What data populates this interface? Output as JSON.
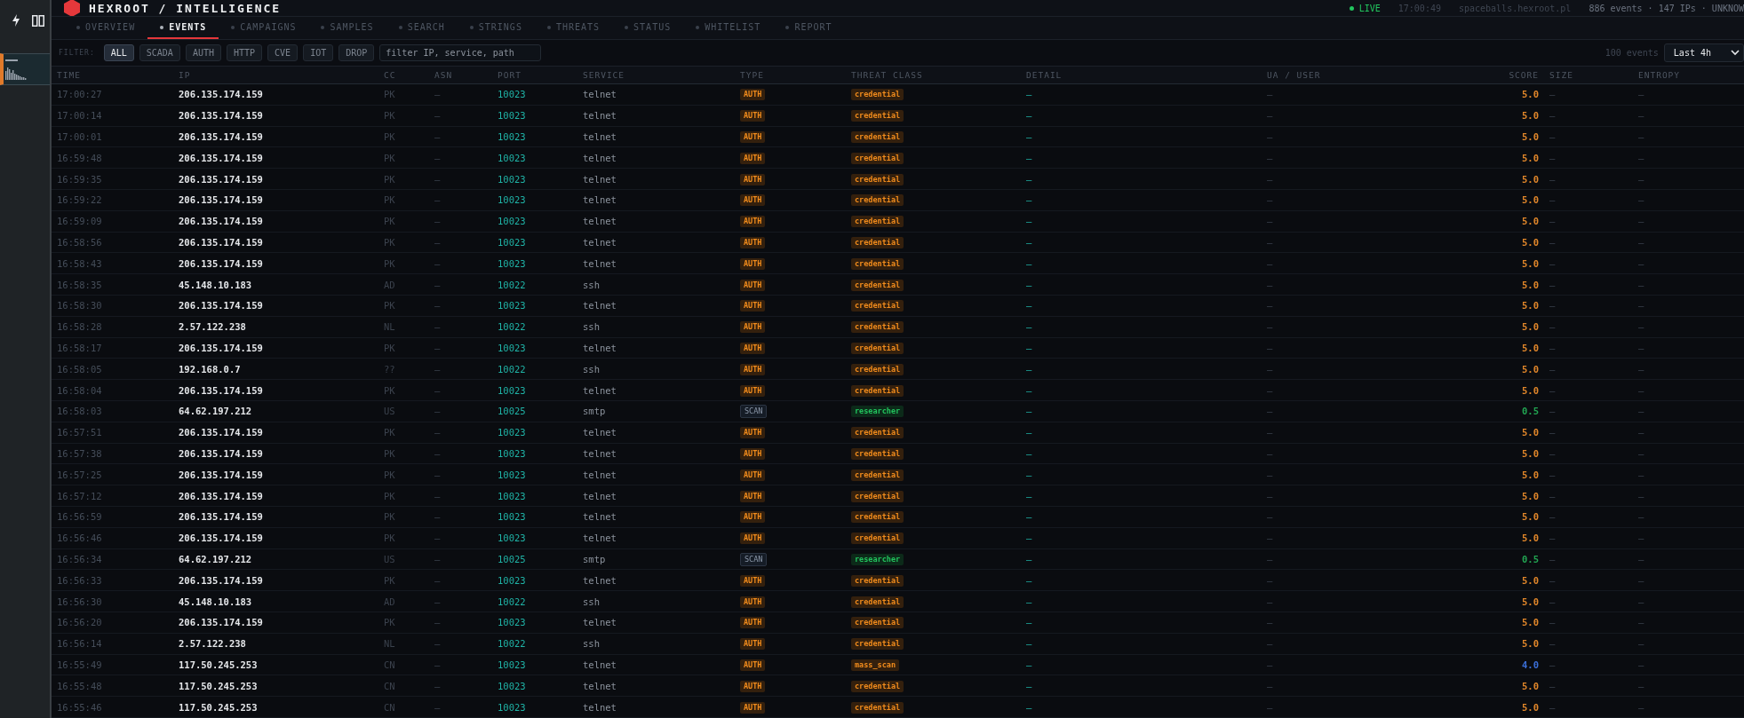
{
  "app": {
    "title": "HEXROOT / INTELLIGENCE"
  },
  "status": {
    "live": "LIVE",
    "clock": "17:00:49",
    "host": "spaceballs.hexroot.pl",
    "summary": "886 events · 147 IPs · UNKNOW"
  },
  "tabs": [
    {
      "label": "OVERVIEW",
      "selected": false
    },
    {
      "label": "EVENTS",
      "selected": true
    },
    {
      "label": "CAMPAIGNS",
      "selected": false
    },
    {
      "label": "SAMPLES",
      "selected": false
    },
    {
      "label": "SEARCH",
      "selected": false
    },
    {
      "label": "STRINGS",
      "selected": false
    },
    {
      "label": "THREATS",
      "selected": false
    },
    {
      "label": "STATUS",
      "selected": false
    },
    {
      "label": "WHITELIST",
      "selected": false
    },
    {
      "label": "REPORT",
      "selected": false
    }
  ],
  "filter": {
    "label": "FILTER:",
    "chips": [
      {
        "label": "ALL",
        "selected": true
      },
      {
        "label": "SCADA",
        "selected": false
      },
      {
        "label": "AUTH",
        "selected": false
      },
      {
        "label": "HTTP",
        "selected": false
      },
      {
        "label": "CVE",
        "selected": false
      },
      {
        "label": "IOT",
        "selected": false
      },
      {
        "label": "DROP",
        "selected": false
      }
    ],
    "search": {
      "placeholder": "filter IP, service, path"
    },
    "count": "100 events",
    "range": "Last 4h"
  },
  "table": {
    "columns": [
      "TIME",
      "IP",
      "CC",
      "ASN",
      "PORT",
      "SERVICE",
      "TYPE",
      "THREAT CLASS",
      "DETAIL",
      "UA / USER",
      "SCORE",
      "SIZE",
      "ENTROPY"
    ],
    "rows": [
      {
        "time": "17:00:27",
        "ip": "206.135.174.159",
        "cc": "PK",
        "asn": "—",
        "port": "10023",
        "service": "telnet",
        "type": {
          "text": "AUTH",
          "kind": "auth"
        },
        "threat_class": {
          "text": "credential",
          "kind": "alert"
        },
        "detail": "—",
        "ua": "—",
        "score": {
          "text": "5.0",
          "color": "#e0862a"
        },
        "size": "—",
        "entropy": "—"
      },
      {
        "time": "17:00:14",
        "ip": "206.135.174.159",
        "cc": "PK",
        "asn": "—",
        "port": "10023",
        "service": "telnet",
        "type": {
          "text": "AUTH",
          "kind": "auth"
        },
        "threat_class": {
          "text": "credential",
          "kind": "alert"
        },
        "detail": "—",
        "ua": "—",
        "score": {
          "text": "5.0",
          "color": "#e0862a"
        },
        "size": "—",
        "entropy": "—"
      },
      {
        "time": "17:00:01",
        "ip": "206.135.174.159",
        "cc": "PK",
        "asn": "—",
        "port": "10023",
        "service": "telnet",
        "type": {
          "text": "AUTH",
          "kind": "auth"
        },
        "threat_class": {
          "text": "credential",
          "kind": "alert"
        },
        "detail": "—",
        "ua": "—",
        "score": {
          "text": "5.0",
          "color": "#e0862a"
        },
        "size": "—",
        "entropy": "—"
      },
      {
        "time": "16:59:48",
        "ip": "206.135.174.159",
        "cc": "PK",
        "asn": "—",
        "port": "10023",
        "service": "telnet",
        "type": {
          "text": "AUTH",
          "kind": "auth"
        },
        "threat_class": {
          "text": "credential",
          "kind": "alert"
        },
        "detail": "—",
        "ua": "—",
        "score": {
          "text": "5.0",
          "color": "#e0862a"
        },
        "size": "—",
        "entropy": "—"
      },
      {
        "time": "16:59:35",
        "ip": "206.135.174.159",
        "cc": "PK",
        "asn": "—",
        "port": "10023",
        "service": "telnet",
        "type": {
          "text": "AUTH",
          "kind": "auth"
        },
        "threat_class": {
          "text": "credential",
          "kind": "alert"
        },
        "detail": "—",
        "ua": "—",
        "score": {
          "text": "5.0",
          "color": "#e0862a"
        },
        "size": "—",
        "entropy": "—"
      },
      {
        "time": "16:59:22",
        "ip": "206.135.174.159",
        "cc": "PK",
        "asn": "—",
        "port": "10023",
        "service": "telnet",
        "type": {
          "text": "AUTH",
          "kind": "auth"
        },
        "threat_class": {
          "text": "credential",
          "kind": "alert"
        },
        "detail": "—",
        "ua": "—",
        "score": {
          "text": "5.0",
          "color": "#e0862a"
        },
        "size": "—",
        "entropy": "—"
      },
      {
        "time": "16:59:09",
        "ip": "206.135.174.159",
        "cc": "PK",
        "asn": "—",
        "port": "10023",
        "service": "telnet",
        "type": {
          "text": "AUTH",
          "kind": "auth"
        },
        "threat_class": {
          "text": "credential",
          "kind": "alert"
        },
        "detail": "—",
        "ua": "—",
        "score": {
          "text": "5.0",
          "color": "#e0862a"
        },
        "size": "—",
        "entropy": "—"
      },
      {
        "time": "16:58:56",
        "ip": "206.135.174.159",
        "cc": "PK",
        "asn": "—",
        "port": "10023",
        "service": "telnet",
        "type": {
          "text": "AUTH",
          "kind": "auth"
        },
        "threat_class": {
          "text": "credential",
          "kind": "alert"
        },
        "detail": "—",
        "ua": "—",
        "score": {
          "text": "5.0",
          "color": "#e0862a"
        },
        "size": "—",
        "entropy": "—"
      },
      {
        "time": "16:58:43",
        "ip": "206.135.174.159",
        "cc": "PK",
        "asn": "—",
        "port": "10023",
        "service": "telnet",
        "type": {
          "text": "AUTH",
          "kind": "auth"
        },
        "threat_class": {
          "text": "credential",
          "kind": "alert"
        },
        "detail": "—",
        "ua": "—",
        "score": {
          "text": "5.0",
          "color": "#e0862a"
        },
        "size": "—",
        "entropy": "—"
      },
      {
        "time": "16:58:35",
        "ip": "45.148.10.183",
        "cc": "AD",
        "asn": "—",
        "port": "10022",
        "service": "ssh",
        "type": {
          "text": "AUTH",
          "kind": "auth"
        },
        "threat_class": {
          "text": "credential",
          "kind": "alert"
        },
        "detail": "—",
        "ua": "—",
        "score": {
          "text": "5.0",
          "color": "#e0862a"
        },
        "size": "—",
        "entropy": "—"
      },
      {
        "time": "16:58:30",
        "ip": "206.135.174.159",
        "cc": "PK",
        "asn": "—",
        "port": "10023",
        "service": "telnet",
        "type": {
          "text": "AUTH",
          "kind": "auth"
        },
        "threat_class": {
          "text": "credential",
          "kind": "alert"
        },
        "detail": "—",
        "ua": "—",
        "score": {
          "text": "5.0",
          "color": "#e0862a"
        },
        "size": "—",
        "entropy": "—"
      },
      {
        "time": "16:58:28",
        "ip": "2.57.122.238",
        "cc": "NL",
        "asn": "—",
        "port": "10022",
        "service": "ssh",
        "type": {
          "text": "AUTH",
          "kind": "auth"
        },
        "threat_class": {
          "text": "credential",
          "kind": "alert"
        },
        "detail": "—",
        "ua": "—",
        "score": {
          "text": "5.0",
          "color": "#e0862a"
        },
        "size": "—",
        "entropy": "—"
      },
      {
        "time": "16:58:17",
        "ip": "206.135.174.159",
        "cc": "PK",
        "asn": "—",
        "port": "10023",
        "service": "telnet",
        "type": {
          "text": "AUTH",
          "kind": "auth"
        },
        "threat_class": {
          "text": "credential",
          "kind": "alert"
        },
        "detail": "—",
        "ua": "—",
        "score": {
          "text": "5.0",
          "color": "#e0862a"
        },
        "size": "—",
        "entropy": "—"
      },
      {
        "time": "16:58:05",
        "ip": "192.168.0.7",
        "cc": "??",
        "asn": "—",
        "port": "10022",
        "service": "ssh",
        "type": {
          "text": "AUTH",
          "kind": "auth"
        },
        "threat_class": {
          "text": "credential",
          "kind": "alert"
        },
        "detail": "—",
        "ua": "—",
        "score": {
          "text": "5.0",
          "color": "#e0862a"
        },
        "size": "—",
        "entropy": "—"
      },
      {
        "time": "16:58:04",
        "ip": "206.135.174.159",
        "cc": "PK",
        "asn": "—",
        "port": "10023",
        "service": "telnet",
        "type": {
          "text": "AUTH",
          "kind": "auth"
        },
        "threat_class": {
          "text": "credential",
          "kind": "alert"
        },
        "detail": "—",
        "ua": "—",
        "score": {
          "text": "5.0",
          "color": "#e0862a"
        },
        "size": "—",
        "entropy": "—"
      },
      {
        "time": "16:58:03",
        "ip": "64.62.197.212",
        "cc": "US",
        "asn": "—",
        "port": "10025",
        "service": "smtp",
        "type": {
          "text": "SCAN",
          "kind": "scan"
        },
        "threat_class": {
          "text": "researcher",
          "kind": "benign"
        },
        "detail": "—",
        "ua": "—",
        "score": {
          "text": "0.5",
          "color": "#22a552"
        },
        "size": "—",
        "entropy": "—"
      },
      {
        "time": "16:57:51",
        "ip": "206.135.174.159",
        "cc": "PK",
        "asn": "—",
        "port": "10023",
        "service": "telnet",
        "type": {
          "text": "AUTH",
          "kind": "auth"
        },
        "threat_class": {
          "text": "credential",
          "kind": "alert"
        },
        "detail": "—",
        "ua": "—",
        "score": {
          "text": "5.0",
          "color": "#e0862a"
        },
        "size": "—",
        "entropy": "—"
      },
      {
        "time": "16:57:38",
        "ip": "206.135.174.159",
        "cc": "PK",
        "asn": "—",
        "port": "10023",
        "service": "telnet",
        "type": {
          "text": "AUTH",
          "kind": "auth"
        },
        "threat_class": {
          "text": "credential",
          "kind": "alert"
        },
        "detail": "—",
        "ua": "—",
        "score": {
          "text": "5.0",
          "color": "#e0862a"
        },
        "size": "—",
        "entropy": "—"
      },
      {
        "time": "16:57:25",
        "ip": "206.135.174.159",
        "cc": "PK",
        "asn": "—",
        "port": "10023",
        "service": "telnet",
        "type": {
          "text": "AUTH",
          "kind": "auth"
        },
        "threat_class": {
          "text": "credential",
          "kind": "alert"
        },
        "detail": "—",
        "ua": "—",
        "score": {
          "text": "5.0",
          "color": "#e0862a"
        },
        "size": "—",
        "entropy": "—"
      },
      {
        "time": "16:57:12",
        "ip": "206.135.174.159",
        "cc": "PK",
        "asn": "—",
        "port": "10023",
        "service": "telnet",
        "type": {
          "text": "AUTH",
          "kind": "auth"
        },
        "threat_class": {
          "text": "credential",
          "kind": "alert"
        },
        "detail": "—",
        "ua": "—",
        "score": {
          "text": "5.0",
          "color": "#e0862a"
        },
        "size": "—",
        "entropy": "—"
      },
      {
        "time": "16:56:59",
        "ip": "206.135.174.159",
        "cc": "PK",
        "asn": "—",
        "port": "10023",
        "service": "telnet",
        "type": {
          "text": "AUTH",
          "kind": "auth"
        },
        "threat_class": {
          "text": "credential",
          "kind": "alert"
        },
        "detail": "—",
        "ua": "—",
        "score": {
          "text": "5.0",
          "color": "#e0862a"
        },
        "size": "—",
        "entropy": "—"
      },
      {
        "time": "16:56:46",
        "ip": "206.135.174.159",
        "cc": "PK",
        "asn": "—",
        "port": "10023",
        "service": "telnet",
        "type": {
          "text": "AUTH",
          "kind": "auth"
        },
        "threat_class": {
          "text": "credential",
          "kind": "alert"
        },
        "detail": "—",
        "ua": "—",
        "score": {
          "text": "5.0",
          "color": "#e0862a"
        },
        "size": "—",
        "entropy": "—"
      },
      {
        "time": "16:56:34",
        "ip": "64.62.197.212",
        "cc": "US",
        "asn": "—",
        "port": "10025",
        "service": "smtp",
        "type": {
          "text": "SCAN",
          "kind": "scan"
        },
        "threat_class": {
          "text": "researcher",
          "kind": "benign"
        },
        "detail": "—",
        "ua": "—",
        "score": {
          "text": "0.5",
          "color": "#22a552"
        },
        "size": "—",
        "entropy": "—"
      },
      {
        "time": "16:56:33",
        "ip": "206.135.174.159",
        "cc": "PK",
        "asn": "—",
        "port": "10023",
        "service": "telnet",
        "type": {
          "text": "AUTH",
          "kind": "auth"
        },
        "threat_class": {
          "text": "credential",
          "kind": "alert"
        },
        "detail": "—",
        "ua": "—",
        "score": {
          "text": "5.0",
          "color": "#e0862a"
        },
        "size": "—",
        "entropy": "—"
      },
      {
        "time": "16:56:30",
        "ip": "45.148.10.183",
        "cc": "AD",
        "asn": "—",
        "port": "10022",
        "service": "ssh",
        "type": {
          "text": "AUTH",
          "kind": "auth"
        },
        "threat_class": {
          "text": "credential",
          "kind": "alert"
        },
        "detail": "—",
        "ua": "—",
        "score": {
          "text": "5.0",
          "color": "#e0862a"
        },
        "size": "—",
        "entropy": "—"
      },
      {
        "time": "16:56:20",
        "ip": "206.135.174.159",
        "cc": "PK",
        "asn": "—",
        "port": "10023",
        "service": "telnet",
        "type": {
          "text": "AUTH",
          "kind": "auth"
        },
        "threat_class": {
          "text": "credential",
          "kind": "alert"
        },
        "detail": "—",
        "ua": "—",
        "score": {
          "text": "5.0",
          "color": "#e0862a"
        },
        "size": "—",
        "entropy": "—"
      },
      {
        "time": "16:56:14",
        "ip": "2.57.122.238",
        "cc": "NL",
        "asn": "—",
        "port": "10022",
        "service": "ssh",
        "type": {
          "text": "AUTH",
          "kind": "auth"
        },
        "threat_class": {
          "text": "credential",
          "kind": "alert"
        },
        "detail": "—",
        "ua": "—",
        "score": {
          "text": "5.0",
          "color": "#e0862a"
        },
        "size": "—",
        "entropy": "—"
      },
      {
        "time": "16:55:49",
        "ip": "117.50.245.253",
        "cc": "CN",
        "asn": "—",
        "port": "10023",
        "service": "telnet",
        "type": {
          "text": "AUTH",
          "kind": "auth"
        },
        "threat_class": {
          "text": "mass_scan",
          "kind": "alert"
        },
        "detail": "—",
        "ua": "—",
        "score": {
          "text": "4.0",
          "color": "#3b6fd8"
        },
        "size": "—",
        "entropy": "—"
      },
      {
        "time": "16:55:48",
        "ip": "117.50.245.253",
        "cc": "CN",
        "asn": "—",
        "port": "10023",
        "service": "telnet",
        "type": {
          "text": "AUTH",
          "kind": "auth"
        },
        "threat_class": {
          "text": "credential",
          "kind": "alert"
        },
        "detail": "—",
        "ua": "—",
        "score": {
          "text": "5.0",
          "color": "#e0862a"
        },
        "size": "—",
        "entropy": "—"
      },
      {
        "time": "16:55:46",
        "ip": "117.50.245.253",
        "cc": "CN",
        "asn": "—",
        "port": "10023",
        "service": "telnet",
        "type": {
          "text": "AUTH",
          "kind": "auth"
        },
        "threat_class": {
          "text": "credential",
          "kind": "alert"
        },
        "detail": "—",
        "ua": "—",
        "score": {
          "text": "5.0",
          "color": "#e0862a"
        },
        "size": "—",
        "entropy": "—"
      }
    ]
  }
}
